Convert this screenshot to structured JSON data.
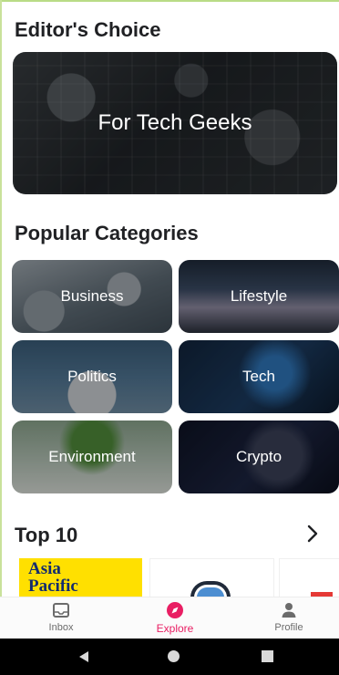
{
  "editors_choice": {
    "title": "Editor's Choice",
    "card_label": "For Tech Geeks"
  },
  "popular_categories": {
    "title": "Popular Categories",
    "items": [
      {
        "label": "Business"
      },
      {
        "label": "Lifestyle"
      },
      {
        "label": "Politics"
      },
      {
        "label": "Tech"
      },
      {
        "label": "Environment"
      },
      {
        "label": "Crypto"
      }
    ]
  },
  "top10": {
    "title": "Top 10",
    "more_icon": "chevron-right-icon",
    "cards": [
      {
        "title_line1": "Asia",
        "title_line2": "Pacific"
      },
      {
        "icon": "mug-logo"
      },
      {
        "icon": "red-logo"
      }
    ]
  },
  "bottom_nav": {
    "items": [
      {
        "label": "Inbox",
        "icon": "inbox-icon"
      },
      {
        "label": "Explore",
        "icon": "compass-icon",
        "active": true
      },
      {
        "label": "Profile",
        "icon": "person-icon"
      }
    ],
    "active_color": "#e91e63"
  },
  "system_nav": {
    "back": "back-icon",
    "home": "home-icon",
    "recent": "recent-apps-icon"
  }
}
